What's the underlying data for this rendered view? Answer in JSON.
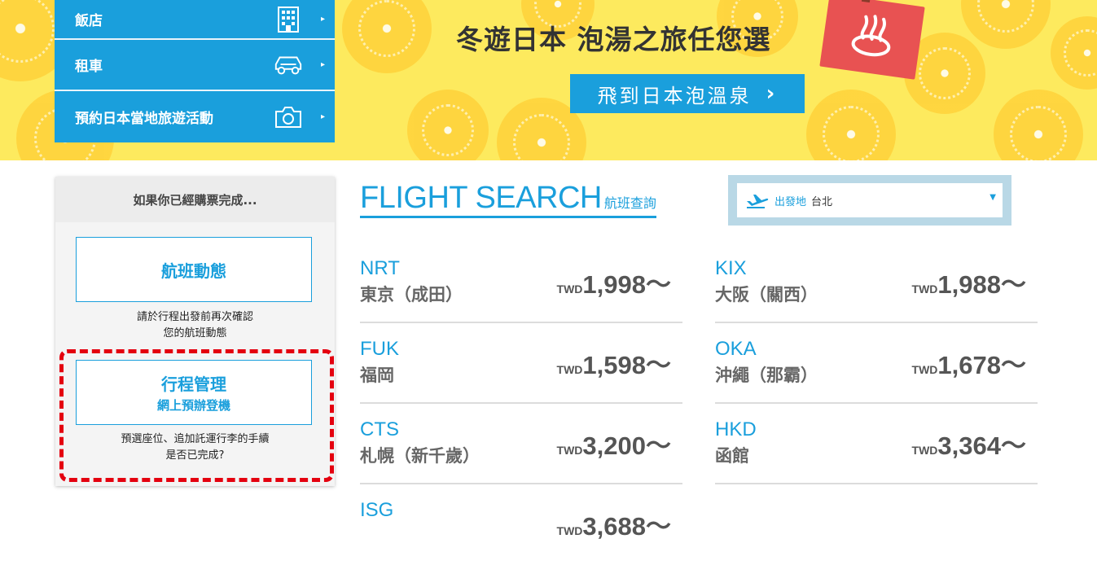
{
  "banner": {
    "title": "冬遊日本 泡湯之旅任您選",
    "button_label": "飛到日本泡溫泉",
    "button_arrow": "›",
    "colors": {
      "background": "#fdea5e",
      "button": "#1a9fdc",
      "flag": "#e85252"
    }
  },
  "menu": {
    "items": [
      {
        "label": "飯店",
        "icon": "building-icon"
      },
      {
        "label": "租車",
        "icon": "car-icon"
      },
      {
        "label": "預約日本當地旅遊活動",
        "icon": "camera-icon"
      }
    ],
    "arrow": "▸"
  },
  "panel": {
    "heading": "如果你已經購票完成...",
    "flight_status_label": "航班動態",
    "flight_status_note_1": "請於行程出發前再次確認",
    "flight_status_note_2": "您的航班動態",
    "manage_label": "行程管理",
    "manage_sublabel": "網上預辦登機",
    "manage_note_1": "預選座位、追加託運行李的手續",
    "manage_note_2": "是否已完成?"
  },
  "flight_search": {
    "title_en": "FLIGHT SEARCH",
    "title_zh": "航班查詢",
    "origin_label": "出發地",
    "origin_city": "台北",
    "routes": [
      {
        "code": "NRT",
        "city": "東京（成田）",
        "currency": "TWD",
        "price": "1,998",
        "suffix": "～"
      },
      {
        "code": "KIX",
        "city": "大阪（關西）",
        "currency": "TWD",
        "price": "1,988",
        "suffix": "～"
      },
      {
        "code": "FUK",
        "city": "福岡",
        "currency": "TWD",
        "price": "1,598",
        "suffix": "～"
      },
      {
        "code": "OKA",
        "city": "沖繩（那霸）",
        "currency": "TWD",
        "price": "1,678",
        "suffix": "～"
      },
      {
        "code": "CTS",
        "city": "札幌（新千歲）",
        "currency": "TWD",
        "price": "3,200",
        "suffix": "～"
      },
      {
        "code": "HKD",
        "city": "函館",
        "currency": "TWD",
        "price": "3,364",
        "suffix": "～"
      },
      {
        "code": "ISG",
        "city": "",
        "currency": "TWD",
        "price": "3,688",
        "suffix": "～"
      }
    ]
  }
}
